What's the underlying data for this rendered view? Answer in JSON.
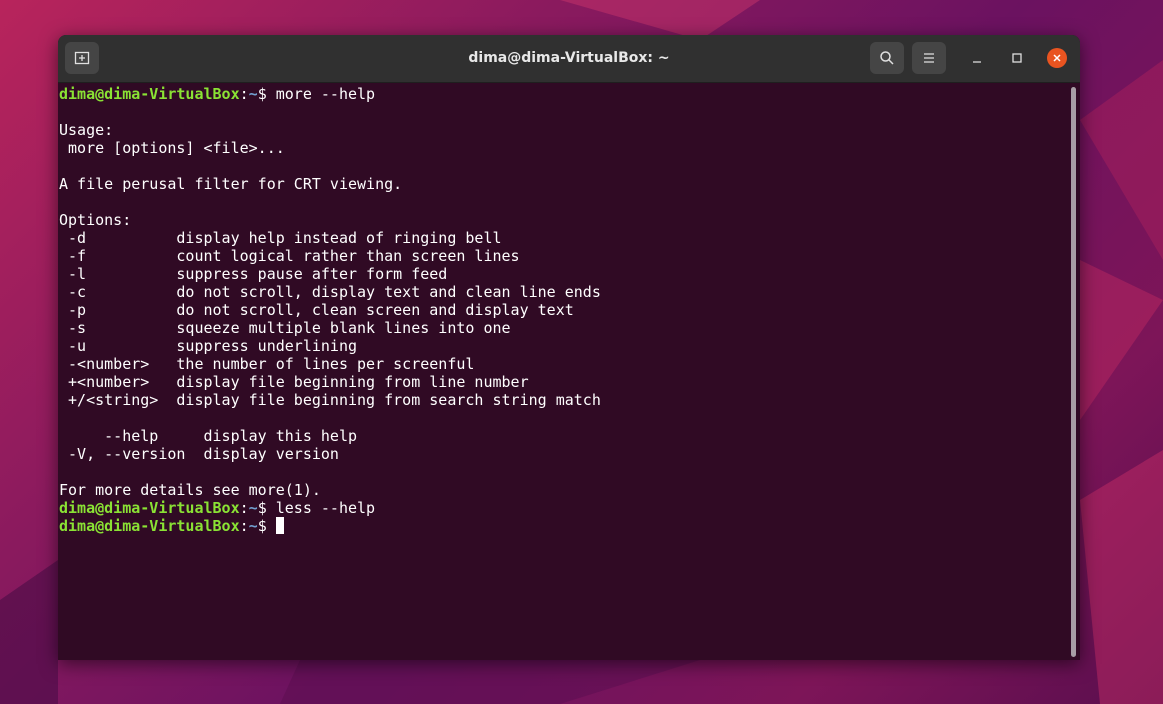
{
  "window": {
    "title": "dima@dima-VirtualBox: ~"
  },
  "titlebar": {
    "new_tab_icon": "new-tab-icon",
    "search_icon": "search-icon",
    "menu_icon": "hamburger-menu-icon",
    "minimize_icon": "minimize-icon",
    "maximize_icon": "maximize-icon",
    "close_icon": "close-icon"
  },
  "prompt": {
    "user_host": "dima@dima-VirtualBox",
    "separator": ":",
    "path": "~",
    "symbol": "$ "
  },
  "commands": [
    "more --help",
    "less --help"
  ],
  "output": [
    "",
    "Usage:",
    " more [options] <file>...",
    "",
    "A file perusal filter for CRT viewing.",
    "",
    "Options:",
    " -d          display help instead of ringing bell",
    " -f          count logical rather than screen lines",
    " -l          suppress pause after form feed",
    " -c          do not scroll, display text and clean line ends",
    " -p          do not scroll, clean screen and display text",
    " -s          squeeze multiple blank lines into one",
    " -u          suppress underlining",
    " -<number>   the number of lines per screenful",
    " +<number>   display file beginning from line number",
    " +/<string>  display file beginning from search string match",
    "",
    "     --help     display this help",
    " -V, --version  display version",
    "",
    "For more details see more(1)."
  ],
  "colors": {
    "terminal_bg": "#300a24",
    "titlebar_bg": "#303030",
    "prompt_user": "#8ae234",
    "prompt_path": "#729fcf",
    "close_button": "#e95420"
  }
}
